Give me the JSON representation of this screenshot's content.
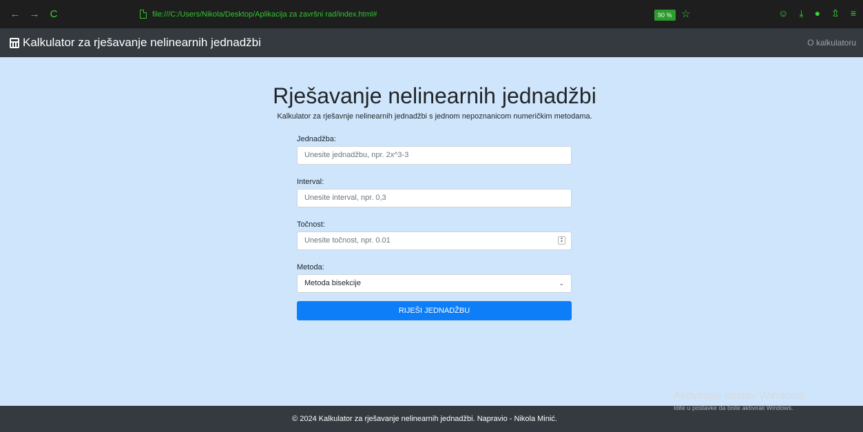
{
  "browser": {
    "back": "←",
    "forward": "→",
    "reload": "C",
    "url": "file:///C:/Users/Nikola/Desktop/Aplikacija za završni rad/index.html#",
    "zoom": "90 %",
    "star": "☆",
    "icons": [
      "pocket-icon",
      "download-icon",
      "account-icon",
      "extensions-icon",
      "menu-icon"
    ],
    "icon_glyphs": [
      "☺",
      "⤓",
      "●",
      "⇬",
      "≡"
    ],
    "accent_color": "#3ad13a"
  },
  "navbar": {
    "brand": "Kalkulator za rješavanje nelinearnih jednadžbi",
    "about_link": "O kalkulatoru"
  },
  "main": {
    "title": "Rješavanje nelinearnih jednadžbi",
    "subtitle": "Kalkulator za rješavnje nelinearnih jednadžbi s jednom nepoznanicom numeričkim metodama."
  },
  "form": {
    "equation_label": "Jednadžba:",
    "equation_placeholder": "Unesite jednadžbu, npr. 2x^3-3",
    "interval_label": "Interval:",
    "interval_placeholder": "Unesite interval, npr. 0,3",
    "accuracy_label": "Točnost:",
    "accuracy_placeholder": "Unesite točnost, npr. 0.01",
    "method_label": "Metoda:",
    "method_selected": "Metoda bisekcije",
    "submit_label": "RIJEŠI JEDNADŽBU",
    "button_color": "#0d7ef8"
  },
  "footer": {
    "text": "© 2024 Kalkulator za rješavanje nelinearnih jednadžbi. Napravio - Nikola Minić."
  },
  "watermark": {
    "line1": "Aktivirajte sustav Windows",
    "line2": "Idite u postavke da biste aktivirali Windows."
  }
}
